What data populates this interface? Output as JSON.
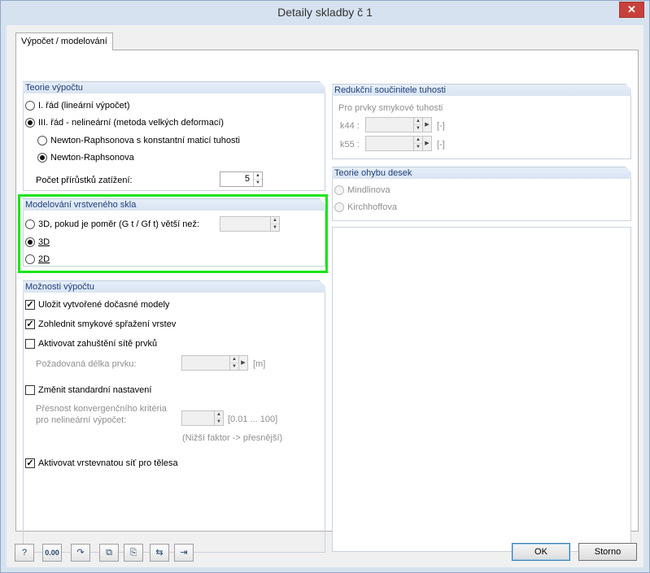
{
  "window": {
    "title": "Detaily skladby č 1",
    "close_label": "✕"
  },
  "tab": {
    "label": "Výpočet / modelování"
  },
  "teorie": {
    "title": "Teorie výpočtu",
    "opt1": "I. řád (lineární výpočet)",
    "opt2": "III. řád - nelineární (metoda velkých deformací)",
    "sub1": "Newton-Raphsonova s konstantní maticí tuhosti",
    "sub2": "Newton-Raphsonova",
    "increments_label": "Počet přírůstků zatížení:",
    "increments_value": "5"
  },
  "modelovani": {
    "title": "Modelování vrstveného skla",
    "opt1": "3D, pokud je poměr (G t / Gf t) větší než:",
    "opt2": "3D",
    "opt3": "2D"
  },
  "moznosti": {
    "title": "Možnosti výpočtu",
    "c1": "Uložit vytvořené dočasné modely",
    "c2": "Zohlednit smykové spřažení vrstev",
    "c3": "Aktivovat zahuštění sítě prvků",
    "element_length_label": "Požadovaná délka prvku:",
    "element_length_unit": "[m]",
    "c4": "Změnit standardní nastavení",
    "precision_label_1": "Přesnost konvergenčního kritéria",
    "precision_label_2": "pro nelineární výpočet:",
    "precision_range": "[0.01 ... 100]",
    "precision_hint": "(Nižší faktor -> přesnější)",
    "c5": "Aktivovat vrstevnatou síť pro tělesa"
  },
  "redukcni": {
    "title": "Redukční součinitele tuhosti",
    "sub": "Pro prvky smykové tuhosti",
    "k44": "k44 :",
    "k55": "k55 :",
    "unit": "[-]"
  },
  "ohyb": {
    "title": "Teorie ohybu desek",
    "opt1": "Mindlinova",
    "opt2": "Kirchhoffova"
  },
  "buttons": {
    "ok": "OK",
    "cancel": "Storno"
  },
  "toolbar": {
    "units_label": "0.00"
  },
  "icons": [
    "help-icon",
    "units-icon",
    "rotate-icon",
    "copy-icon",
    "paste-icon",
    "import-icon",
    "export-icon"
  ]
}
